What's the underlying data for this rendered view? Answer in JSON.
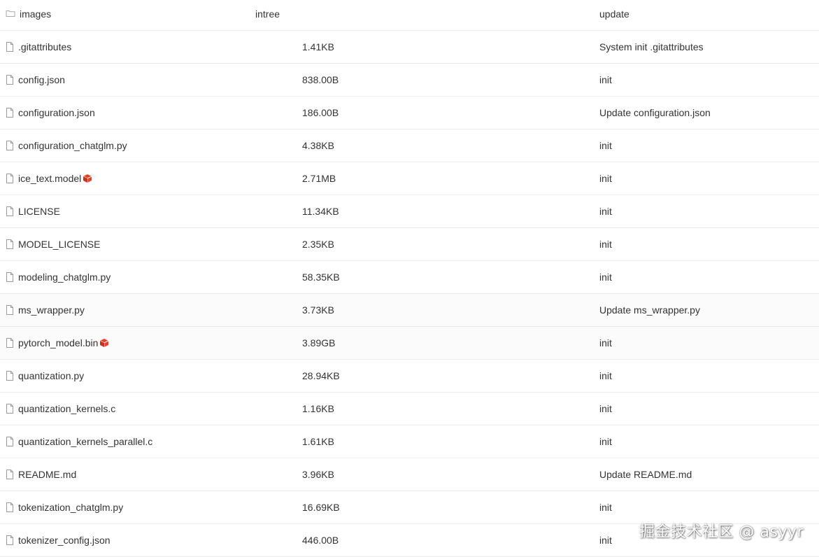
{
  "columns": {
    "name_header": "images",
    "size_header": "intree",
    "message_header": "update"
  },
  "files": [
    {
      "name": ".gitattributes",
      "size": "1.41KB",
      "message": "System init .gitattributes",
      "lfs": false
    },
    {
      "name": "config.json",
      "size": "838.00B",
      "message": "init",
      "lfs": false
    },
    {
      "name": "configuration.json",
      "size": "186.00B",
      "message": "Update configuration.json",
      "lfs": false
    },
    {
      "name": "configuration_chatglm.py",
      "size": "4.38KB",
      "message": "init",
      "lfs": false
    },
    {
      "name": "ice_text.model",
      "size": "2.71MB",
      "message": "init",
      "lfs": true
    },
    {
      "name": "LICENSE",
      "size": "11.34KB",
      "message": "init",
      "lfs": false
    },
    {
      "name": "MODEL_LICENSE",
      "size": "2.35KB",
      "message": "init",
      "lfs": false
    },
    {
      "name": "modeling_chatglm.py",
      "size": "58.35KB",
      "message": "init",
      "lfs": false
    },
    {
      "name": "ms_wrapper.py",
      "size": "3.73KB",
      "message": "Update ms_wrapper.py",
      "lfs": false
    },
    {
      "name": "pytorch_model.bin",
      "size": "3.89GB",
      "message": "init",
      "lfs": true
    },
    {
      "name": "quantization.py",
      "size": "28.94KB",
      "message": "init",
      "lfs": false
    },
    {
      "name": "quantization_kernels.c",
      "size": "1.16KB",
      "message": "init",
      "lfs": false
    },
    {
      "name": "quantization_kernels_parallel.c",
      "size": "1.61KB",
      "message": "init",
      "lfs": false
    },
    {
      "name": "README.md",
      "size": "3.96KB",
      "message": "Update README.md",
      "lfs": false
    },
    {
      "name": "tokenization_chatglm.py",
      "size": "16.69KB",
      "message": "init",
      "lfs": false
    },
    {
      "name": "tokenizer_config.json",
      "size": "446.00B",
      "message": "init",
      "lfs": false
    }
  ],
  "watermark": "掘金技术社区 @ asyyr",
  "colors": {
    "text": "#333333",
    "row_border": "#ececec",
    "lfs_icon": "#e0452b",
    "file_icon": "#999999"
  },
  "icons": {
    "folder": "folder-icon",
    "file": "file-icon",
    "lfs": "lfs-box-icon"
  }
}
